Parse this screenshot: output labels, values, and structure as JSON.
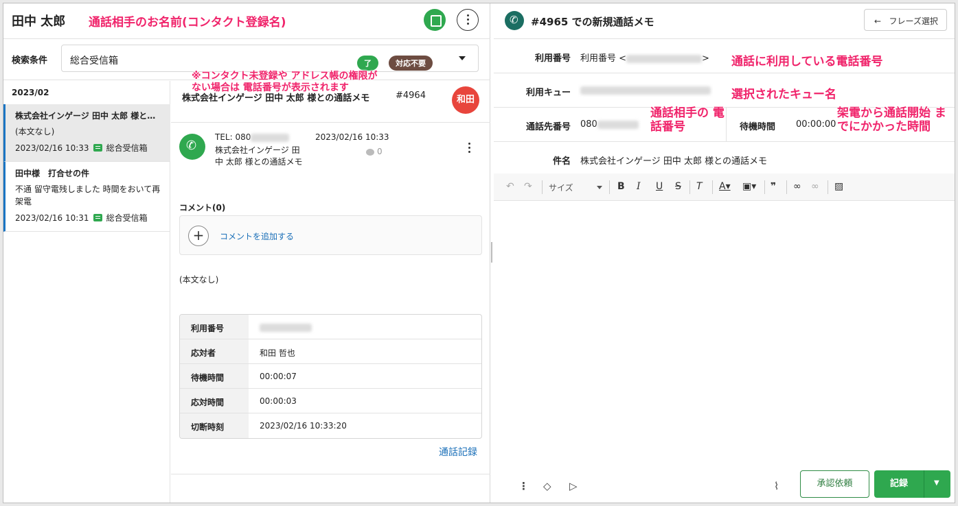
{
  "left_header": {
    "contact_name": "田中 太郎",
    "annotation_name": "通話相手のお名前(コンタクト登録名)"
  },
  "search": {
    "label": "検索条件",
    "value": "総合受信箱",
    "tag_done": "了",
    "tag_none": "対応不要",
    "annotation": "※コンタクト未登録や アドレス帳の権限がない場合は 電話番号が表示されます"
  },
  "list": {
    "month": "2023/02",
    "items": [
      {
        "title": "株式会社インゲージ 田中 太郎 様と…",
        "text": "(本文なし)",
        "datetime": "2023/02/16 10:33",
        "queue": "総合受信箱"
      },
      {
        "title": "田中様　打合せの件",
        "text": "不通 留守電残しました 時間をおいて再架電",
        "datetime": "2023/02/16 10:31",
        "queue": "総合受信箱"
      }
    ]
  },
  "detail": {
    "title": "株式会社インゲージ 田中 太郎 様との通話メモ",
    "number": "#4964",
    "avatar": "和田",
    "call": {
      "tel_prefix": "TEL: 080",
      "memo": "株式会社インゲージ 田中 太郎 様との通話メモ",
      "datetime": "2023/02/16 10:33",
      "count": "0"
    },
    "comment_label": "コメント(0)",
    "comment_add": "コメントを追加する",
    "body": "(本文なし)",
    "info": [
      {
        "key": "利用番号",
        "value": ""
      },
      {
        "key": "応対者",
        "value": "和田 哲也"
      },
      {
        "key": "待機時間",
        "value": "00:00:07"
      },
      {
        "key": "応対時間",
        "value": "00:00:03"
      },
      {
        "key": "切断時刻",
        "value": "2023/02/16 10:33:20"
      }
    ],
    "log_link": "通話記録"
  },
  "right": {
    "title": "#4965 での新規通話メモ",
    "phrase_button": "フレーズ選択",
    "rows": {
      "number_label": "利用番号",
      "number_value_prefix": "利用番号 <",
      "number_value_suffix": ">",
      "queue_label": "利用キュー",
      "dest_label": "通話先番号",
      "dest_value_prefix": "080",
      "wait_label": "待機時間",
      "wait_value": "00:00:00",
      "subject_label": "件名",
      "subject_value": "株式会社インゲージ 田中 太郎 様との通話メモ"
    },
    "annotations": {
      "number": "通話に利用している電話番号",
      "queue": "選択されたキュー名",
      "dest": "通話相手の 電話番号",
      "wait": "架電から通話開始 までにかかった時間"
    },
    "toolbar": {
      "size_label": "サイズ"
    },
    "approve_button": "承認依頼",
    "record_button": "記録"
  },
  "colors": {
    "accent_green": "#2fa84f",
    "annotation_pink": "#f0246b",
    "link_blue": "#1a6fb8",
    "avatar_red": "#e8453c"
  }
}
